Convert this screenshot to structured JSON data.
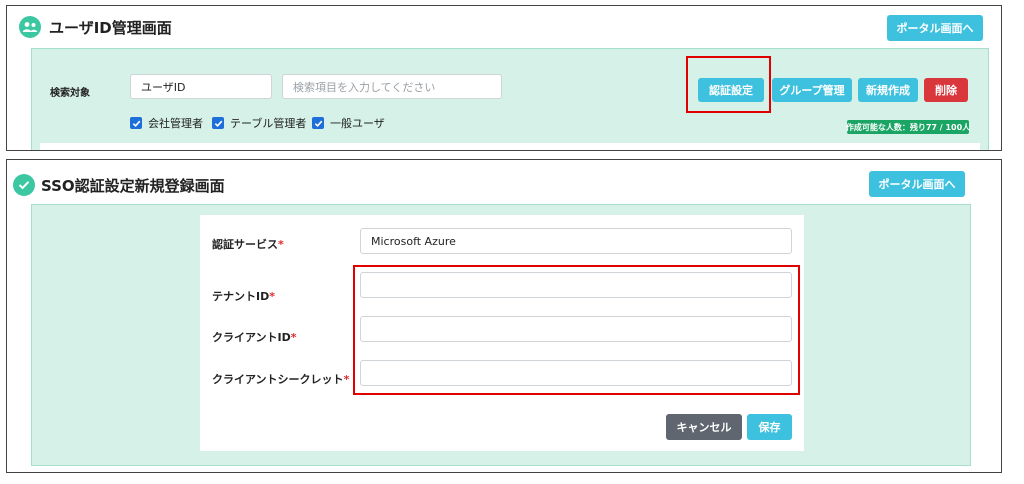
{
  "colors": {
    "accent_teal": "#3cc7a3",
    "button_info": "#3ec1de",
    "button_danger": "#d9373c",
    "button_dark": "#5f6670",
    "panel_bg": "#d5f1e8",
    "highlight_red": "#e00000",
    "badge_green": "#1aa564"
  },
  "top_screen": {
    "title_icon": "users-icon",
    "title": "ユーザID管理画面",
    "portal_button": "ポータル画面へ",
    "search": {
      "label": "検索対象",
      "target_value": "ユーザID",
      "keyword_placeholder": "検索項目を入力してください"
    },
    "filters": [
      {
        "label": "会社管理者",
        "checked": true
      },
      {
        "label": "テーブル管理者",
        "checked": true
      },
      {
        "label": "一般ユーザ",
        "checked": true
      }
    ],
    "buttons": {
      "auth_settings": "認証設定",
      "group_management": "グループ管理",
      "new_create": "新規作成",
      "delete": "削除"
    },
    "capacity_badge": "作成可能な人数：残り77 / 100人"
  },
  "bottom_screen": {
    "title_icon": "check-circle-icon",
    "title": "SSO認証設定新規登録画面",
    "portal_button": "ポータル画面へ",
    "form": {
      "auth_service": {
        "label": "認証サービス",
        "required_mark": "*",
        "value": "Microsoft Azure"
      },
      "tenant_id": {
        "label": "テナントID",
        "required_mark": "*",
        "value": ""
      },
      "client_id": {
        "label": "クライアントID",
        "required_mark": "*",
        "value": ""
      },
      "client_secret": {
        "label": "クライアントシークレット",
        "required_mark": "*",
        "value": ""
      }
    },
    "buttons": {
      "cancel": "キャンセル",
      "save": "保存"
    }
  }
}
